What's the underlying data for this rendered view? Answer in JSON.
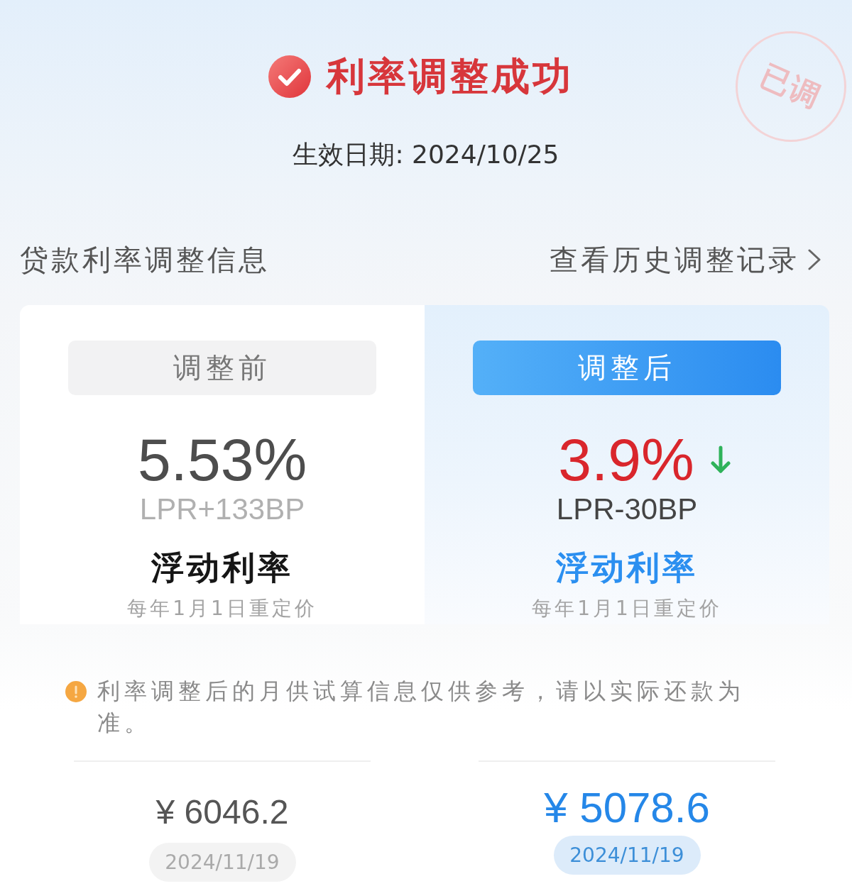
{
  "header": {
    "title": "利率调整成功",
    "effective_date": "生效日期: 2024/10/25"
  },
  "stamp": {
    "text": "已调"
  },
  "section": {
    "title": "贷款利率调整信息",
    "link": "查看历史调整记录"
  },
  "comparison": [
    {
      "kind": "before",
      "label": "调整前",
      "rate": "5.53%",
      "decreased": false,
      "spread": "LPR+133BP",
      "rate_type": "浮动利率",
      "reprice": "每年1月1日重定价"
    },
    {
      "kind": "after",
      "label": "调整后",
      "rate": "3.9%",
      "decreased": true,
      "spread": "LPR-30BP",
      "rate_type": "浮动利率",
      "reprice": "每年1月1日重定价"
    }
  ],
  "notice": {
    "text": "利率调整后的月供试算信息仅供参考，请以实际还款为准。"
  },
  "monthly_payments": [
    {
      "kind": "before",
      "amount": "¥ 6046.2",
      "date": "2024/11/19"
    },
    {
      "kind": "after",
      "amount": "¥ 5078.6",
      "date": "2024/11/19"
    }
  ]
}
